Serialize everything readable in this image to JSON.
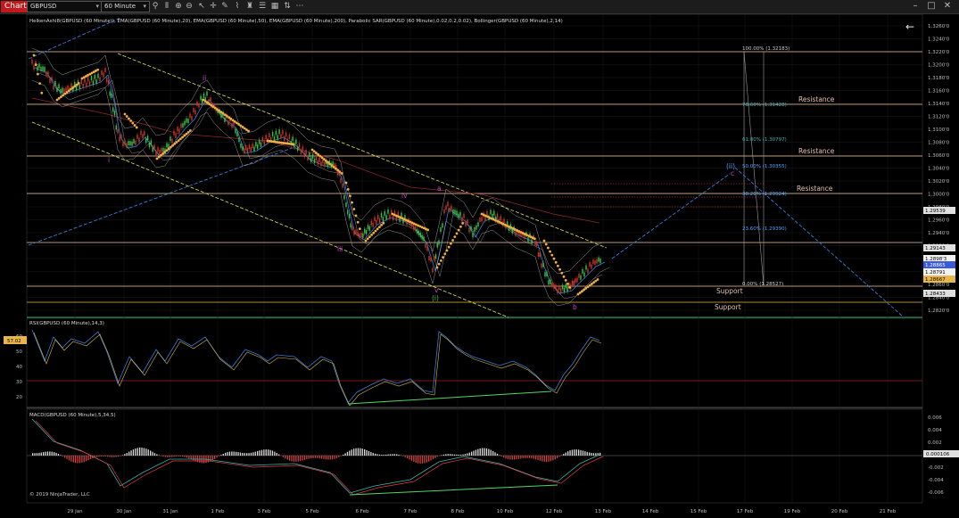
{
  "app": {
    "tab": "Chart",
    "instrument": "GBPUSD",
    "interval": "60 Minute"
  },
  "toolbar": {
    "icons": [
      "search-icon",
      "bar-style-icon",
      "zoom-in-icon",
      "zoom-out-icon",
      "pointer-icon",
      "crosshair-icon",
      "draw-icon",
      "indicators-icon",
      "strategy-icon",
      "properties-icon",
      "data-box-icon",
      "chart-trader-icon",
      "more-icon"
    ],
    "window_icons": [
      "minimize-icon",
      "maximize-icon",
      "close-icon"
    ]
  },
  "price_panel": {
    "indicator_legend": "HeikenAshi8(GBPUSD (60 Minute)), EMA(GBPUSD (60 Minute),20), EMA(GBPUSD (60 Minute),50), EMA(GBPUSD (60 Minute),200), Parabolic SAR(GBPUSD (60 Minute),0.02,0.2,0.02), Bollinger(GBPUSD (60 Minute),2,14)",
    "y_ticks": [
      "1.3260'0",
      "1.3240'0",
      "1.3220'0",
      "1.3200'0",
      "1.3180'0",
      "1.3160'0",
      "1.3140'0",
      "1.3120'0",
      "1.3100'0",
      "1.3080'0",
      "1.3060'0",
      "1.3040'0",
      "1.3020'0",
      "1.3000'0",
      "1.2980'0",
      "1.2960'0",
      "1.2940'0",
      "1.2920'0",
      "1.2900'0",
      "1.2880'0",
      "1.2860'0",
      "1.2840'0",
      "1.2820'0"
    ],
    "price_labels": [
      {
        "text": "1.29539",
        "bg": "#e0e0e0",
        "fg": "#000"
      },
      {
        "text": "1.29143",
        "bg": "#e0e0e0",
        "fg": "#000"
      },
      {
        "text": "1.2898'3",
        "bg": "#f2f2f2",
        "fg": "#000"
      },
      {
        "text": "1.28865",
        "bg": "#3a5ad9",
        "fg": "#fff"
      },
      {
        "text": "1.28791",
        "bg": "#f2f2f2",
        "fg": "#000"
      },
      {
        "text": "1.28667",
        "bg": "#e8b64a",
        "fg": "#000"
      },
      {
        "text": "1.28433",
        "bg": "#e0e0e0",
        "fg": "#000"
      }
    ],
    "fib": [
      {
        "label": "100.00% (1.32183)",
        "color": "#cccccc"
      },
      {
        "label": "61.80% (1.30797)",
        "color": "#3fb3b3"
      },
      {
        "label": "50.00% (1.30355)",
        "color": "#4aa3ff"
      },
      {
        "label": "38.20% (1.29924)",
        "color": "#4aa3ff"
      },
      {
        "label": "23.60% (1.29390)",
        "color": "#4aa3ff"
      },
      {
        "label": "0.00% (1.28527)",
        "color": "#cccccc"
      },
      {
        "label": "78.60% (1.31428)",
        "color": "#3fb3b3"
      }
    ],
    "levels": {
      "resistance": "Resistance",
      "support": "Support"
    },
    "waves": [
      "i",
      "ii",
      "iii",
      "iv",
      "v",
      "a",
      "b",
      "c",
      "(i)",
      "(ii)",
      "c"
    ]
  },
  "rsi_panel": {
    "legend": "RSI(GBPUSD (60 Minute),14,3)",
    "y_ticks": [
      "60",
      "50",
      "40",
      "30",
      "20"
    ],
    "current": "57.02"
  },
  "macd_panel": {
    "legend": "MACD(GBPUSD (60 Minute),5,34,5)",
    "y_ticks": [
      "0.006",
      "0.004",
      "0.002",
      "0",
      "-0.002",
      "-0.004",
      "-0.006"
    ],
    "current": "0.000106",
    "copyright": "© 2019 NinjaTrader, LLC"
  },
  "x_ticks": [
    "29 Jan",
    "30 Jan",
    "31 Jan",
    "1 Feb",
    "3 Feb",
    "5 Feb",
    "6 Feb",
    "7 Feb",
    "8 Feb",
    "10 Feb",
    "12 Feb",
    "13 Feb",
    "14 Feb",
    "15 Feb",
    "17 Feb",
    "19 Feb",
    "20 Feb",
    "21 Feb"
  ],
  "colors": {
    "sar": "#f0b040",
    "candle_up": "#3fbf4f",
    "candle_down": "#c0392b",
    "rsi": "#3a7bd5",
    "rsi_sig": "#d9b84a",
    "macd_line": "#3fb0b0",
    "macd_sig": "#e04040",
    "divergence": "#4cd964",
    "channel": "#e6e64c",
    "trendline": "#3a7bd5"
  }
}
